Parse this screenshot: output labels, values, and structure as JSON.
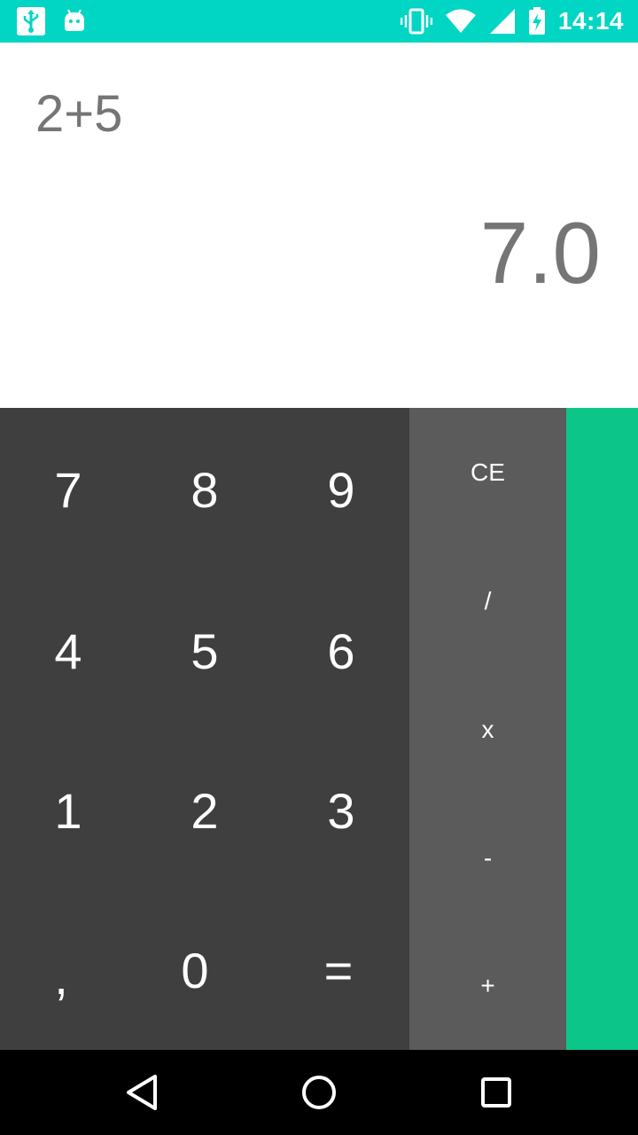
{
  "status_bar": {
    "time": "14:14",
    "left_icons": [
      "usb-icon",
      "android-debug-icon"
    ],
    "right_icons": [
      "vibrate-icon",
      "wifi-icon",
      "cell-signal-icon",
      "battery-charging-icon"
    ],
    "background": "#00d6c3"
  },
  "display": {
    "expression": "2+5",
    "result": "7.0"
  },
  "keypad": {
    "digits": {
      "k7": "7",
      "k8": "8",
      "k9": "9",
      "k4": "4",
      "k5": "5",
      "k6": "6",
      "k1": "1",
      "k2": "2",
      "k3": "3",
      "comma": ",",
      "k0": "0",
      "equals": "="
    },
    "operators": {
      "clear": "CE",
      "divide": "/",
      "multiply": "x",
      "subtract": "-",
      "add": "+"
    },
    "colors": {
      "digits_bg": "#3f3f3f",
      "operators_bg": "#5b5b5b",
      "side_panel_bg": "#0bc688"
    }
  },
  "nav_bar": {
    "icons": [
      "back-icon",
      "home-icon",
      "recents-icon"
    ]
  }
}
